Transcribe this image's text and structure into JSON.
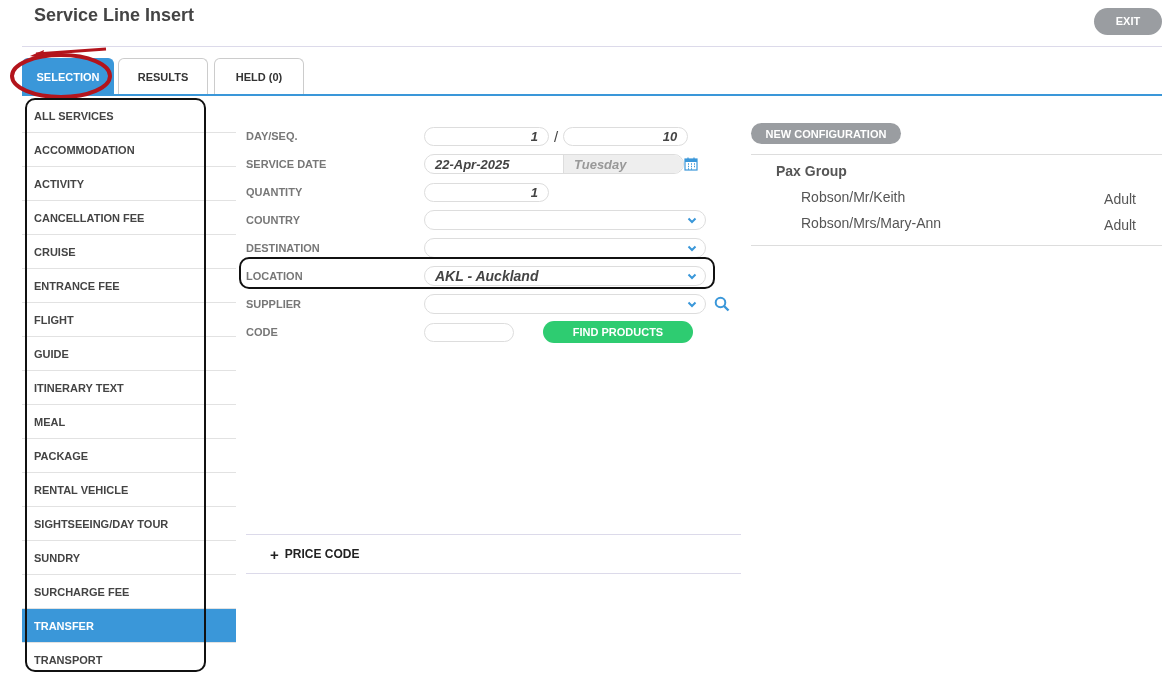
{
  "header": {
    "title": "Service Line Insert",
    "exit_button": "EXIT"
  },
  "tabs": [
    {
      "label": "SELECTION",
      "selected": true
    },
    {
      "label": "RESULTS",
      "selected": false
    },
    {
      "label": "HELD (0)",
      "selected": false
    }
  ],
  "service_types": [
    {
      "label": "ALL SERVICES",
      "selected": false
    },
    {
      "label": "ACCOMMODATION",
      "selected": false
    },
    {
      "label": "ACTIVITY",
      "selected": false
    },
    {
      "label": "CANCELLATION FEE",
      "selected": false
    },
    {
      "label": "CRUISE",
      "selected": false
    },
    {
      "label": "ENTRANCE FEE",
      "selected": false
    },
    {
      "label": "FLIGHT",
      "selected": false
    },
    {
      "label": "GUIDE",
      "selected": false
    },
    {
      "label": "ITINERARY TEXT",
      "selected": false
    },
    {
      "label": "MEAL",
      "selected": false
    },
    {
      "label": "PACKAGE",
      "selected": false
    },
    {
      "label": "RENTAL VEHICLE",
      "selected": false
    },
    {
      "label": "SIGHTSEEING/DAY TOUR",
      "selected": false
    },
    {
      "label": "SUNDRY",
      "selected": false
    },
    {
      "label": "SURCHARGE FEE",
      "selected": false
    },
    {
      "label": "TRANSFER",
      "selected": true
    },
    {
      "label": "TRANSPORT",
      "selected": false
    }
  ],
  "form": {
    "rows": [
      {
        "kind": "pair",
        "label": "DAY/SEQ.",
        "value": "1",
        "separator": "/",
        "value_2": "10"
      },
      {
        "kind": "date",
        "label": "SERVICE DATE",
        "value": "22-Apr-2025",
        "weekday": "Tuesday"
      },
      {
        "kind": "number",
        "label": "QUANTITY",
        "value": "1"
      },
      {
        "kind": "select",
        "label": "COUNTRY"
      },
      {
        "kind": "select",
        "label": "DESTINATION"
      },
      {
        "kind": "select",
        "label": "LOCATION",
        "value": "AKL - Auckland"
      },
      {
        "kind": "select-search",
        "label": "SUPPLIER"
      },
      {
        "kind": "code",
        "label": "CODE",
        "button": "FIND PRODUCTS"
      }
    ]
  },
  "price_code": {
    "icon": "+",
    "label": "PRICE CODE"
  },
  "pax": {
    "button": "NEW CONFIGURATION",
    "group_title": "Pax Group",
    "passengers": [
      {
        "name": "Robson/Mr/Keith",
        "type": "Adult"
      },
      {
        "name": "Robson/Mrs/Mary-Ann",
        "type": "Adult"
      }
    ]
  }
}
